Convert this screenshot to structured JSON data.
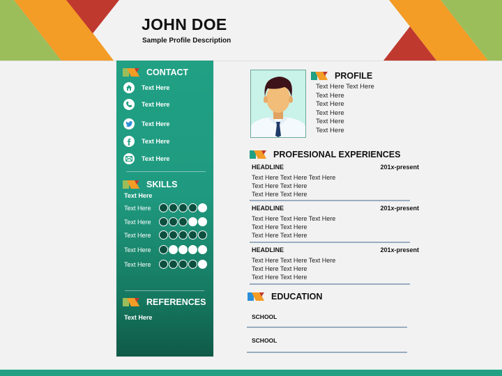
{
  "header": {
    "name": "JOHN DOE",
    "description": "Sample Profile Description"
  },
  "colors": {
    "green": "#9bbe5b",
    "orange": "#f39c26",
    "red": "#c0392f",
    "teal": "#21a084",
    "dark_teal": "#0d4f3f",
    "blue": "#2b8fd8"
  },
  "sidebar": {
    "contact": {
      "title": "CONTACT",
      "items": [
        {
          "icon": "home-icon",
          "text": "Text Here"
        },
        {
          "icon": "phone-icon",
          "text": "Text Here"
        },
        {
          "icon": "twitter-icon",
          "text": "Text Here"
        },
        {
          "icon": "facebook-icon",
          "text": "Text Here"
        },
        {
          "icon": "mail-icon",
          "text": "Text Here"
        }
      ]
    },
    "skills": {
      "title": "SKILLS",
      "subtitle": "Text Here",
      "items": [
        {
          "label": "Text Here",
          "rating": 1,
          "max": 5
        },
        {
          "label": "Text Here",
          "rating": 2,
          "max": 5
        },
        {
          "label": "Text Here",
          "rating": 0,
          "max": 5
        },
        {
          "label": "Text Here",
          "rating": 4,
          "max": 5
        },
        {
          "label": "Text Here",
          "rating": 1,
          "max": 5
        }
      ]
    },
    "references": {
      "title": "REFERENCES",
      "text": "Text Here"
    }
  },
  "profile": {
    "title": "PROFILE",
    "lines": [
      "Text Here Text Here",
      "Text Here",
      "Text Here",
      "Text Here",
      "Text Here",
      "Text Here"
    ]
  },
  "experience": {
    "title": "PROFESIONAL EXPERIENCES",
    "items": [
      {
        "headline": "HEADLINE",
        "period": "201x-present",
        "lines": [
          "Text Here Text Here Text Here",
          "Text Here Text Here",
          "Text Here Text Here"
        ]
      },
      {
        "headline": "HEADLINE",
        "period": "201x-present",
        "lines": [
          "Text Here Text Here Text Here",
          "Text Here Text Here",
          "Text Here Text Here"
        ]
      },
      {
        "headline": "HEADLINE",
        "period": "201x-present",
        "lines": [
          "Text Here Text Here Text Here",
          "Text Here Text Here",
          "Text Here Text Here"
        ]
      }
    ]
  },
  "education": {
    "title": "EDUCATION",
    "schools": [
      "SCHOOL",
      "SCHOOL"
    ]
  }
}
